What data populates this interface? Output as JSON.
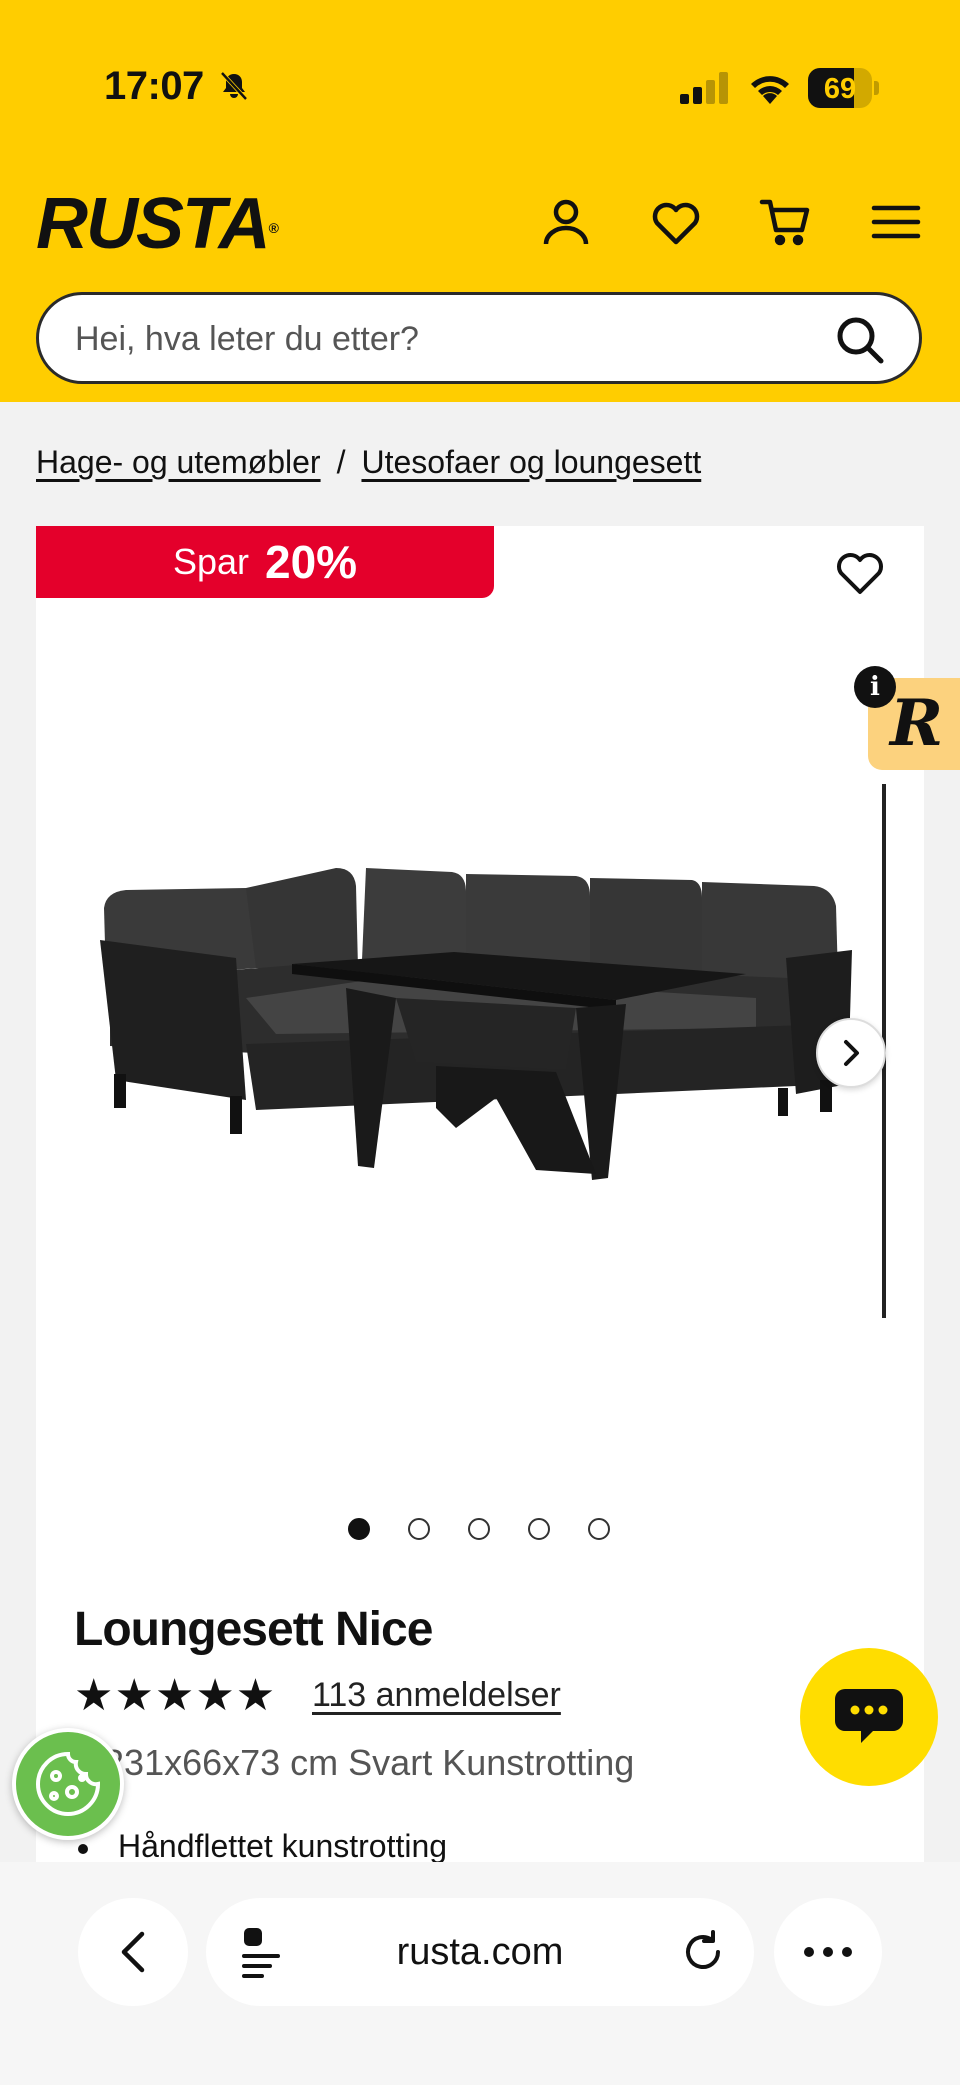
{
  "status_bar": {
    "time": "17:07",
    "battery": "69"
  },
  "header": {
    "logo": "RUSTA",
    "search_placeholder": "Hei, hva leter du etter?"
  },
  "breadcrumb": [
    "Hage- og utemøbler",
    "Utesofaer og loungesett"
  ],
  "product": {
    "badge_label": "Spar",
    "badge_value": "20%",
    "title": "Loungesett Nice",
    "stars": "★★★★★",
    "rating": 5,
    "reviews_link": "113 anmeldelser",
    "dimensions": "5/231x66x73 cm Svart Kunstrotting",
    "bullet_1": "Håndflettet kunstrotting",
    "image_count": 5,
    "active_image": 1
  },
  "browser": {
    "url": "rusta.com"
  },
  "colors": {
    "brand_yellow": "#ffcd00",
    "sale_red": "#e4002b",
    "cookie_green": "#6bbf4e"
  }
}
